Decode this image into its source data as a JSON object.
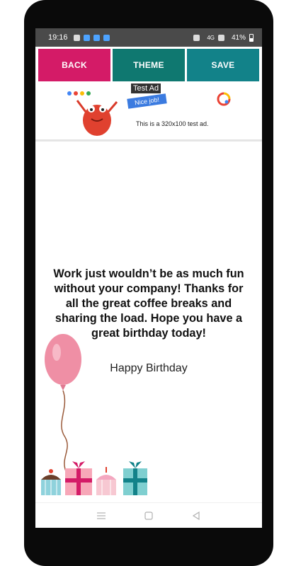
{
  "status_bar": {
    "time": "19:16",
    "network": "4G",
    "battery": "41%",
    "icons": [
      "settings-icon",
      "photo-icon",
      "car-icon",
      "accessibility-icon",
      "vibrate-icon",
      "signal-icon",
      "battery-icon"
    ]
  },
  "toolbar": {
    "back_label": "BACK",
    "theme_label": "THEME",
    "save_label": "SAVE",
    "colors": {
      "back": "#d41b67",
      "theme": "#0f7870",
      "save": "#128289"
    }
  },
  "ad": {
    "label": "Test Ad",
    "badge": "Nice job!",
    "text": "This is a 320x100 test ad."
  },
  "card": {
    "message": "Work just wouldn’t be as much fun without your company! Thanks for all the great coffee breaks and sharing the load. Hope you have a great birthday today!",
    "greeting": "Happy Birthday"
  },
  "nav_bar": {
    "icons": [
      "recent-apps-icon",
      "home-icon",
      "back-icon"
    ]
  }
}
